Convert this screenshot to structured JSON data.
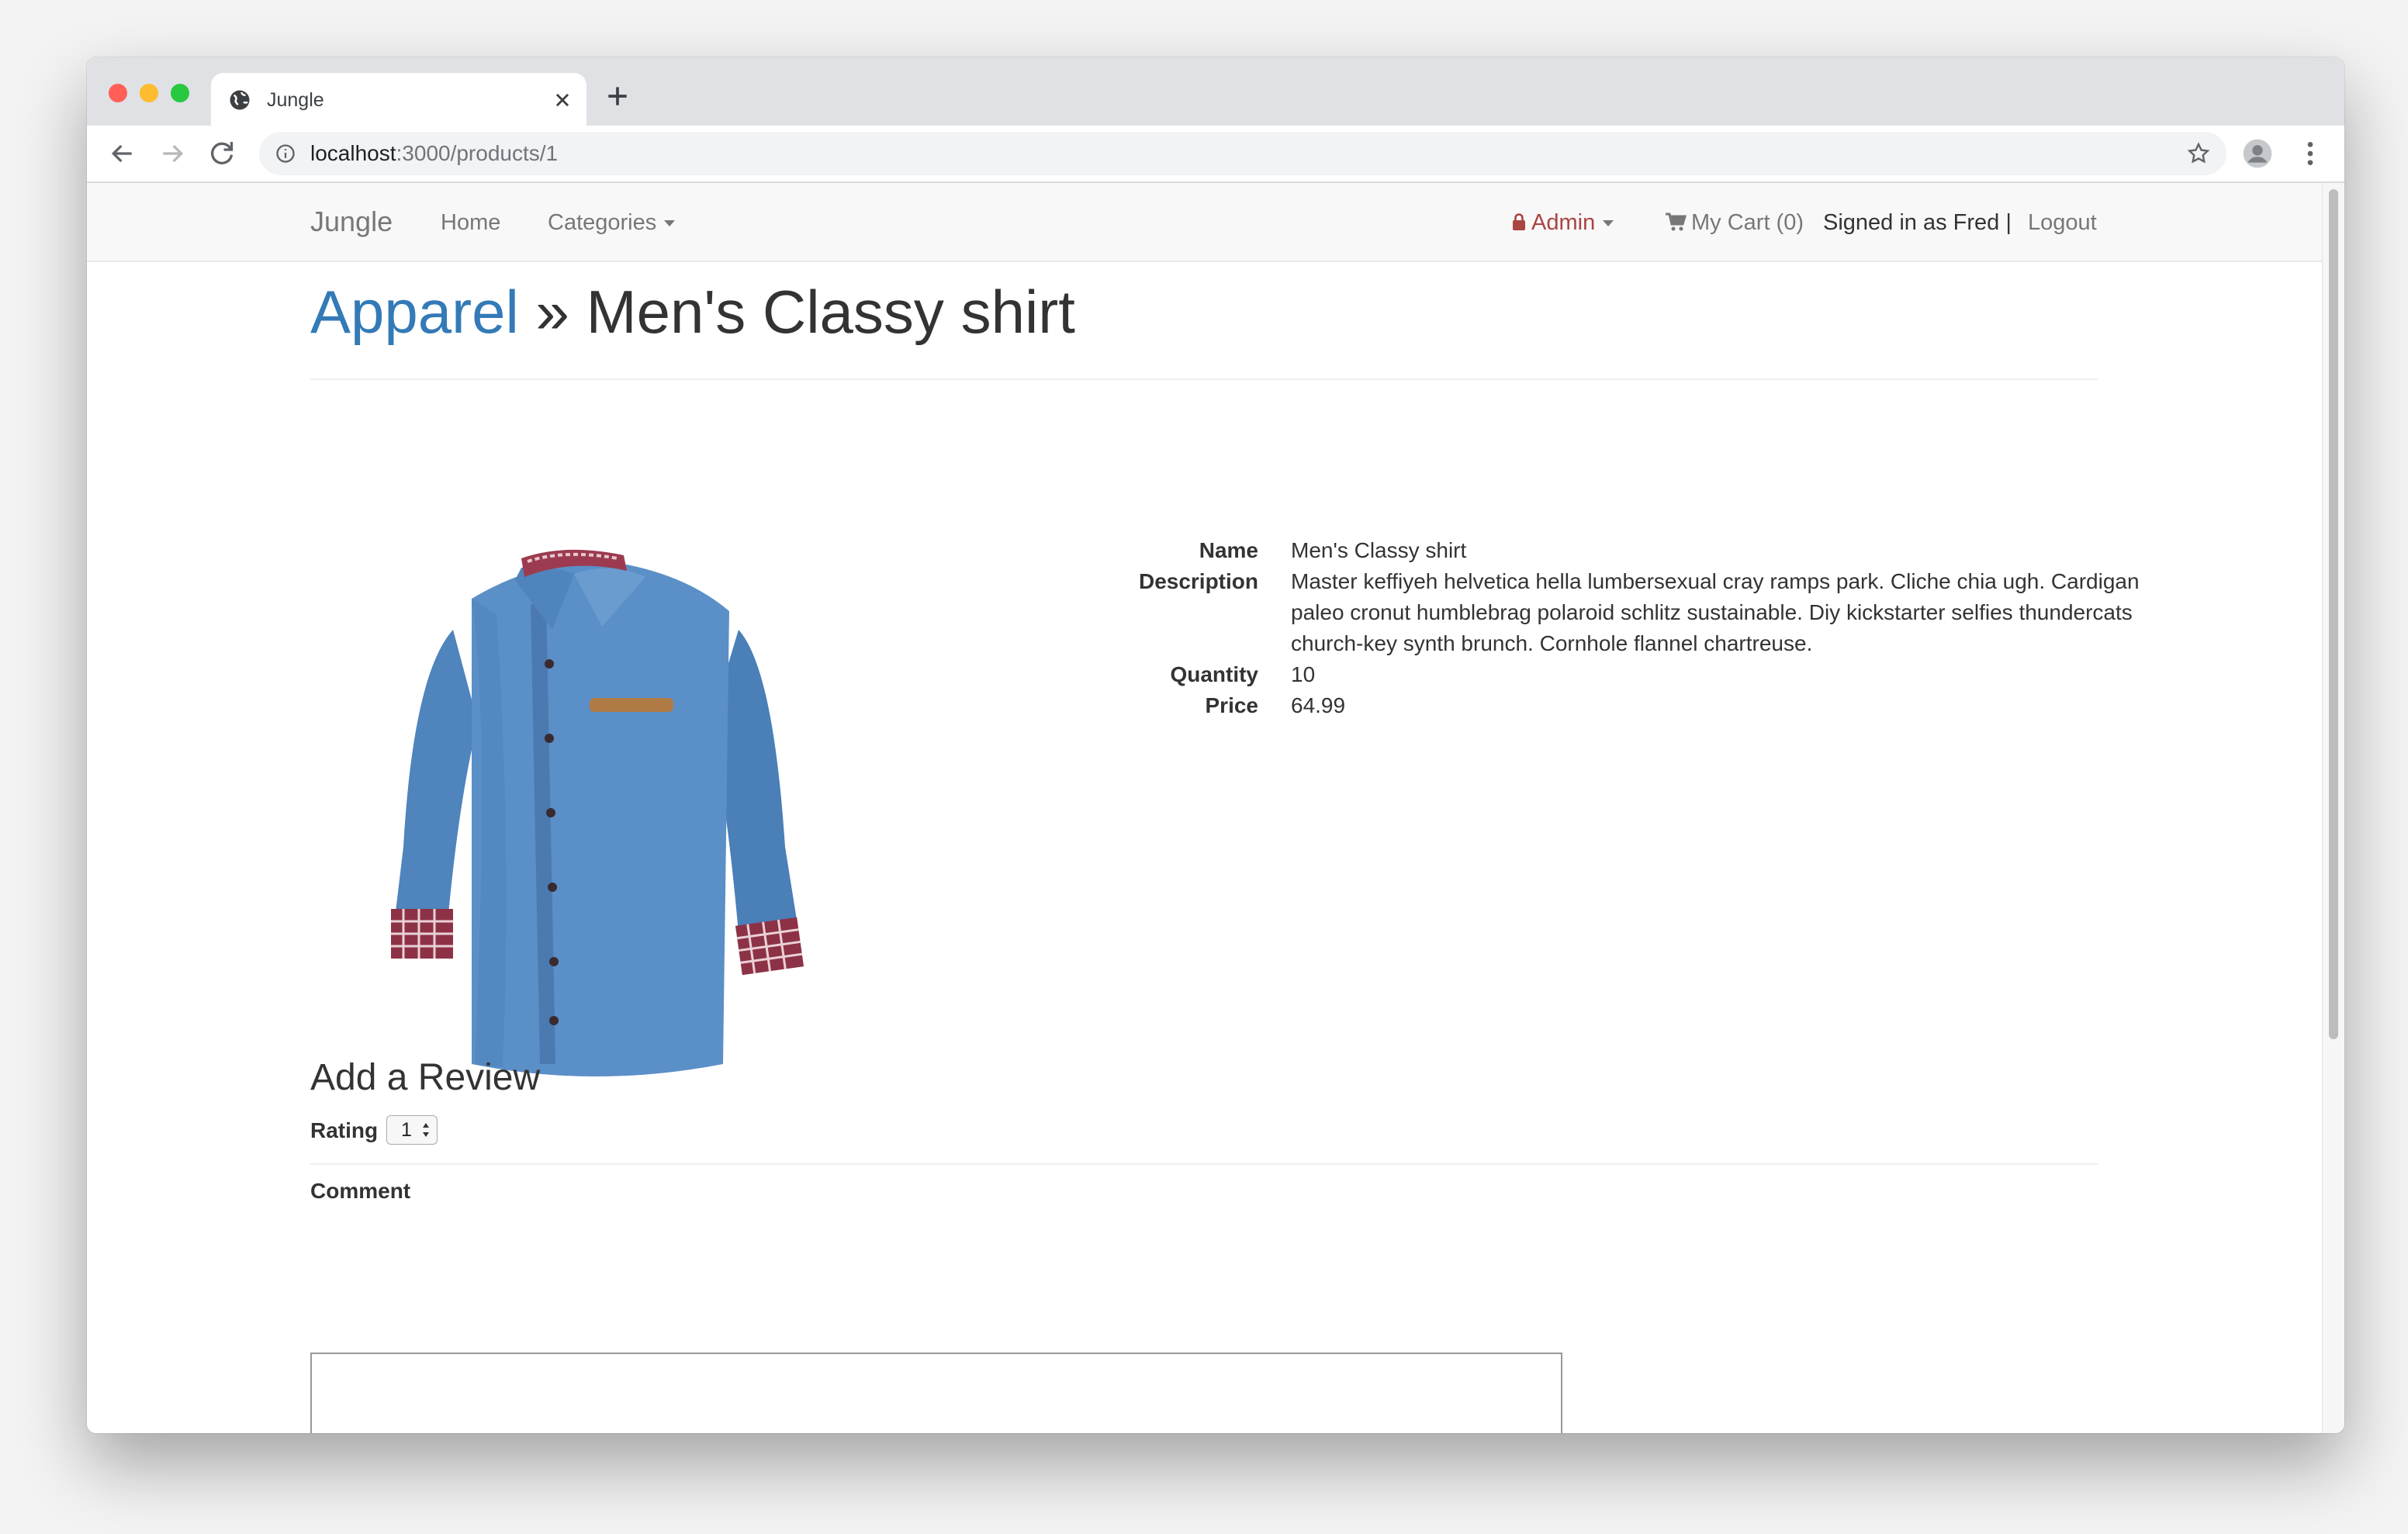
{
  "browser": {
    "tab_title": "Jungle",
    "url_host": "localhost",
    "url_path": ":3000/products/1"
  },
  "nav": {
    "brand": "Jungle",
    "home": "Home",
    "categories": "Categories",
    "admin": "Admin",
    "cart": "My Cart (0)",
    "signed_in": "Signed in as Fred |",
    "logout": "Logout"
  },
  "page": {
    "category": "Apparel",
    "separator": "»",
    "title": "Men's Classy shirt"
  },
  "product": {
    "image_alt": "Men's Classy shirt",
    "details": [
      {
        "label": "Name",
        "value": "Men's Classy shirt"
      },
      {
        "label": "Description",
        "value": "Master keffiyeh helvetica hella lumbersexual cray ramps park. Cliche chia ugh. Cardigan paleo cronut humblebrag polaroid schlitz sustainable. Diy kickstarter selfies thundercats church-key synth brunch. Cornhole flannel chartreuse."
      },
      {
        "label": "Quantity",
        "value": "10"
      },
      {
        "label": "Price",
        "value": "64.99"
      }
    ]
  },
  "review": {
    "heading": "Add a Review",
    "rating_label": "Rating",
    "rating_value": "1",
    "comment_label": "Comment",
    "comment_value": ""
  },
  "colors": {
    "link_blue": "#337ab7",
    "admin_red": "#a94442",
    "navbar_bg": "#f8f8f8",
    "shirt_blue": "#5b8fc7"
  },
  "icons": {
    "favicon": "globe-icon",
    "back": "arrow-left-icon",
    "forward": "arrow-right-icon",
    "reload": "reload-icon",
    "site_info": "info-icon",
    "bookmark": "star-icon",
    "profile": "profile-icon",
    "menu": "kebab-menu-icon",
    "admin": "lock-icon",
    "cart": "shopping-cart-icon"
  }
}
